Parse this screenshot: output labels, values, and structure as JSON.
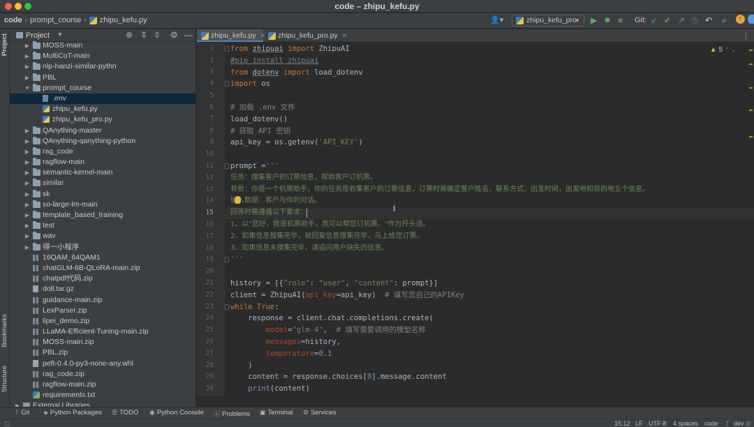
{
  "window": {
    "title": "code – zhipu_kefu.py"
  },
  "navbar": {
    "breadcrumb": [
      "code",
      "prompt_course",
      "zhipu_kefu.py"
    ],
    "run_config": "zhipu_kefu_pro",
    "git_label": "Git:"
  },
  "left_strip": {
    "project": "Project",
    "bookmarks": "Bookmarks",
    "structure": "Structure"
  },
  "project_panel": {
    "title": "Project",
    "items": [
      {
        "label": "MOSS-main",
        "type": "folder",
        "depth": 1,
        "expanded": false
      },
      {
        "label": "MultiCoT-main",
        "type": "folder",
        "depth": 1,
        "expanded": false
      },
      {
        "label": "nlp-hanzi-similar-pythn",
        "type": "folder",
        "depth": 1,
        "expanded": false
      },
      {
        "label": "PBL",
        "type": "folder",
        "depth": 1,
        "expanded": false
      },
      {
        "label": "prompt_course",
        "type": "folder",
        "depth": 1,
        "expanded": true
      },
      {
        "label": ".env",
        "type": "env",
        "depth": 2,
        "selected": true
      },
      {
        "label": "zhipu_kefu.py",
        "type": "py",
        "depth": 2
      },
      {
        "label": "zhipu_kefu_pro.py",
        "type": "py",
        "depth": 2
      },
      {
        "label": "QAnything-master",
        "type": "folder",
        "depth": 1,
        "expanded": false
      },
      {
        "label": "QAnything-qanything-python",
        "type": "folder",
        "depth": 1,
        "expanded": false
      },
      {
        "label": "rag_code",
        "type": "folder",
        "depth": 1,
        "expanded": false
      },
      {
        "label": "ragflow-main",
        "type": "folder",
        "depth": 1,
        "expanded": false
      },
      {
        "label": "semantic-kernel-main",
        "type": "folder",
        "depth": 1,
        "expanded": false
      },
      {
        "label": "similar",
        "type": "folder",
        "depth": 1,
        "expanded": false
      },
      {
        "label": "sk",
        "type": "folder",
        "depth": 1,
        "expanded": false
      },
      {
        "label": "so-large-lm-main",
        "type": "folder",
        "depth": 1,
        "expanded": false
      },
      {
        "label": "template_based_training",
        "type": "folder",
        "depth": 1,
        "expanded": false
      },
      {
        "label": "test",
        "type": "folder",
        "depth": 1,
        "expanded": false
      },
      {
        "label": "wav",
        "type": "folder",
        "depth": 1,
        "expanded": false
      },
      {
        "label": "得一小程序",
        "type": "folder",
        "depth": 1,
        "expanded": false
      },
      {
        "label": "16QAM_64QAM1",
        "type": "zip",
        "depth": 1
      },
      {
        "label": "chatGLM-6B-QLoRA-main.zip",
        "type": "zip",
        "depth": 1
      },
      {
        "label": "chatpdf代码.zip",
        "type": "zip",
        "depth": 1
      },
      {
        "label": "doll.tar.gz",
        "type": "doc",
        "depth": 1
      },
      {
        "label": "guidance-main.zip",
        "type": "zip",
        "depth": 1
      },
      {
        "label": "LexParser.zip",
        "type": "zip",
        "depth": 1
      },
      {
        "label": "lipei_demo.zip",
        "type": "zip",
        "depth": 1
      },
      {
        "label": "LLaMA-Efficient-Tuning-main.zip",
        "type": "zip",
        "depth": 1
      },
      {
        "label": "MOSS-main.zip",
        "type": "zip",
        "depth": 1
      },
      {
        "label": "PBL.zip",
        "type": "zip",
        "depth": 1
      },
      {
        "label": "peft-0.4.0-py3-none-any.whl",
        "type": "doc",
        "depth": 1
      },
      {
        "label": "rag_code.zip",
        "type": "zip",
        "depth": 1
      },
      {
        "label": "ragflow-main.zip",
        "type": "zip",
        "depth": 1
      },
      {
        "label": "requirements.txt",
        "type": "req",
        "depth": 1
      },
      {
        "label": "External Libraries",
        "type": "lib",
        "depth": 0,
        "expanded": false
      }
    ]
  },
  "tabs": [
    {
      "label": "zhipu_kefu.py",
      "active": true
    },
    {
      "label": "zhipu_kefu_pro.py",
      "active": false
    }
  ],
  "editor": {
    "warning_count": "5",
    "current_line": 15,
    "lines": [
      {
        "n": "1",
        "html": "<span class='tok-kw'>from</span> <span class='tok-ul'>zhipuai</span> <span class='tok-kw'>import</span> ZhipuAI"
      },
      {
        "n": "2",
        "html": "<span class='tok-cm tok-ul'>#pip install zhipuai</span>"
      },
      {
        "n": "3",
        "html": "<span class='tok-kw'>from</span> <span class='tok-ul'>dotenv</span> <span class='tok-kw'>import</span> load_dotenv"
      },
      {
        "n": "4",
        "html": "<span class='tok-kw'>import</span> os"
      },
      {
        "n": "5",
        "html": ""
      },
      {
        "n": "6",
        "html": "<span class='tok-cm'># 加载 .env 文件</span>"
      },
      {
        "n": "7",
        "html": "load_dotenv()"
      },
      {
        "n": "8",
        "html": "<span class='tok-cm'># 获取 API 密钥</span>"
      },
      {
        "n": "9",
        "html": "api_key = os.getenv(<span class='tok-str'>'API_KEY'</span>)"
      },
      {
        "n": "10",
        "html": ""
      },
      {
        "n": "11",
        "html": "prompt =<span class='tok-str'>'''</span>"
      },
      {
        "n": "12",
        "html": "任务：搜集客户的订票信息，帮助客户订机票。",
        "cn": true
      },
      {
        "n": "13",
        "html": "背景：你是一个机票助手，你的任务是收集客户的订票信息，订票时需确定客户姓名、联系方式、出发时间，出发地和目的地五个信息。",
        "cn": true
      },
      {
        "n": "14",
        "html": "输入数据：客户与你的对话。",
        "cn": true
      },
      {
        "n": "15",
        "html": "回答时需遵循以下要求：",
        "cn": true
      },
      {
        "n": "16",
        "html": "1、以\"您好，我是机票助手，我可以帮您订机票。\"作为开头语。",
        "cn": true
      },
      {
        "n": "17",
        "html": "2、如果信息搜集完毕，就回复信息搜集完毕，马上给您订票。",
        "cn": true
      },
      {
        "n": "18",
        "html": "3、如果信息未搜集完毕，请追问用户缺失的信息。",
        "cn": true
      },
      {
        "n": "19",
        "html": "<span class='tok-str'>'''</span>"
      },
      {
        "n": "20",
        "html": ""
      },
      {
        "n": "21",
        "html": "history = [{<span class='tok-str'>\"role\"</span>: <span class='tok-str'>\"user\"</span>, <span class='tok-str'>\"content\"</span>: prompt}]"
      },
      {
        "n": "22",
        "html": "client = ZhipuAI(<span class='tok-kwarg'>api_key</span>=api_key)  <span class='tok-cm'># 填写您自己的APIKey</span>"
      },
      {
        "n": "23",
        "html": "<span class='tok-kw'>while</span> <span class='tok-kw'>True</span>:"
      },
      {
        "n": "24",
        "html": "    response = client.chat.completions.create("
      },
      {
        "n": "25",
        "html": "        <span class='tok-kwarg'>model</span>=<span class='tok-str'>\"glm-4\"</span>,  <span class='tok-cm'># 填写需要调用的模型名称</span>"
      },
      {
        "n": "26",
        "html": "        <span class='tok-kwarg'>messages</span>=history,"
      },
      {
        "n": "27",
        "html": "        <span class='tok-kwarg'>temperature</span>=<span class='tok-num'>0.1</span>"
      },
      {
        "n": "28",
        "html": "    )"
      },
      {
        "n": "29",
        "html": "    content = response.choices[<span class='tok-num'>0</span>].message.content"
      },
      {
        "n": "30",
        "html": "    <span class='tok-kw' style='color:#8888c6'>print</span>(content)"
      }
    ]
  },
  "bottom_tools": [
    {
      "label": "Git",
      "icon": "branch-icon"
    },
    {
      "label": "Python Packages",
      "icon": "layers-icon"
    },
    {
      "label": "TODO",
      "icon": "list-icon"
    },
    {
      "label": "Python Console",
      "icon": "console-icon"
    },
    {
      "label": "Problems",
      "icon": "info-icon"
    },
    {
      "label": "Terminal",
      "icon": "terminal-icon"
    },
    {
      "label": "Services",
      "icon": "services-icon"
    }
  ],
  "status": {
    "position": "15:12",
    "line_sep": "LF",
    "encoding": "UTF-8",
    "indent": "4 spaces",
    "interpreter": "code",
    "branch": "dev"
  }
}
